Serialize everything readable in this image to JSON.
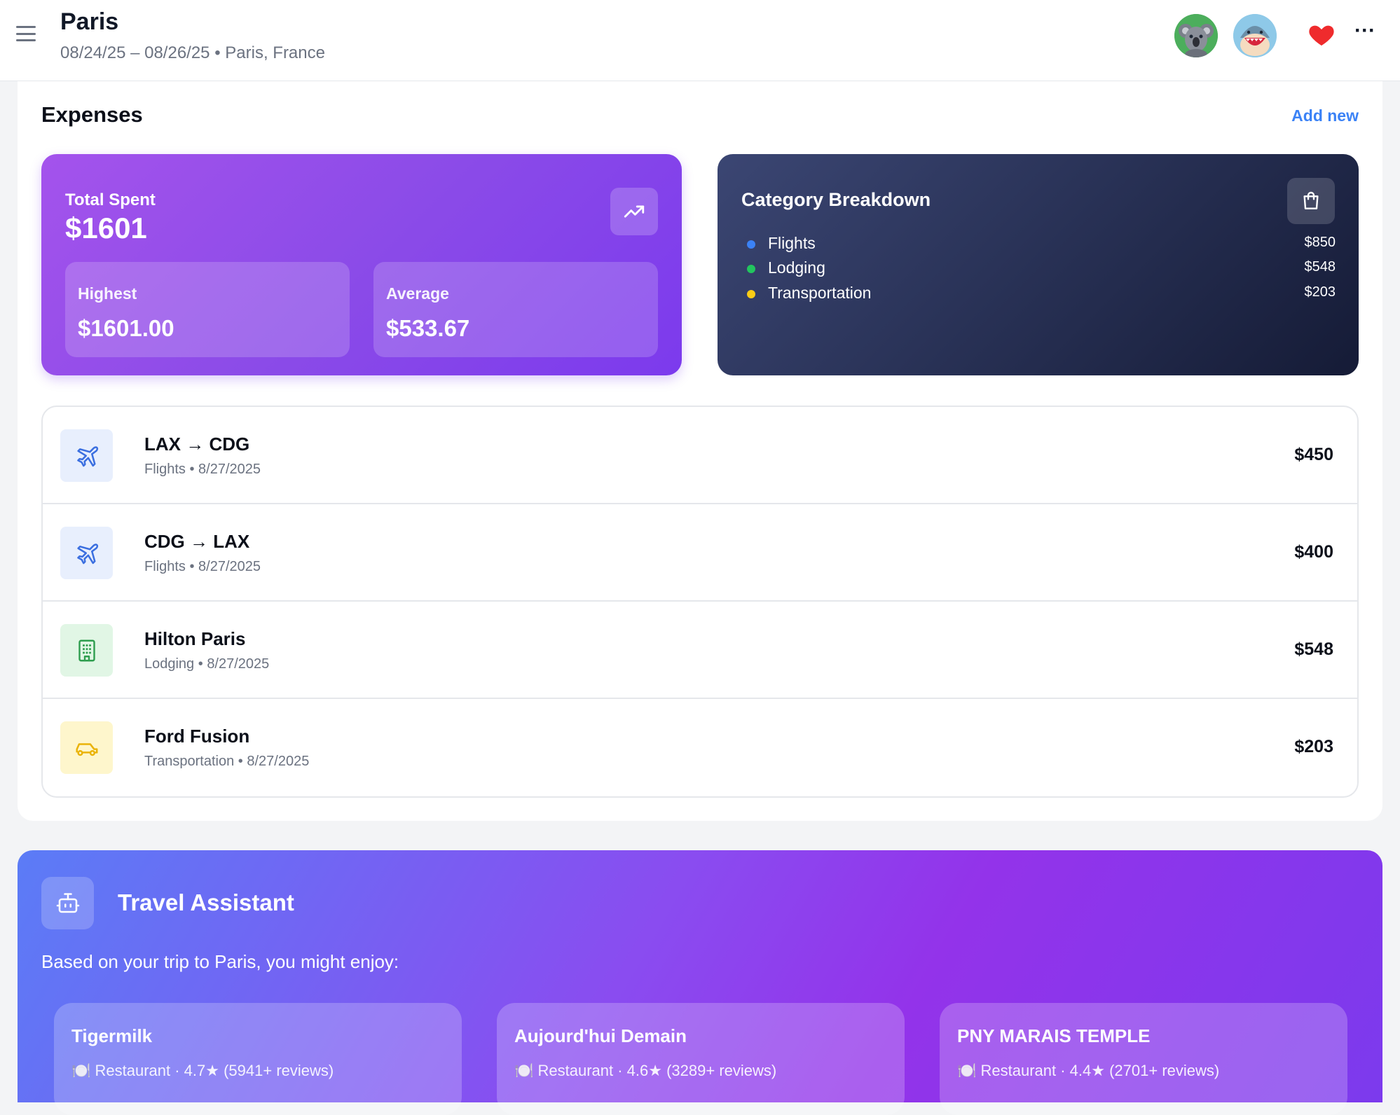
{
  "header": {
    "title": "Paris",
    "subtitle": "08/24/25 – 08/26/25 • Paris, France",
    "menu_icon": "hamburger-icon",
    "avatars": [
      "koala-avatar",
      "shark-avatar"
    ],
    "favorite_icon": "heart-icon",
    "favorite_color": "#ef2b2d",
    "more_label": "···"
  },
  "expenses": {
    "title": "Expenses",
    "add_new_label": "Add new",
    "total": {
      "label": "Total Spent",
      "value": "$1601",
      "icon": "trending-up-icon",
      "highest_label": "Highest",
      "highest_value": "$1601.00",
      "average_label": "Average",
      "average_value": "$533.67"
    },
    "breakdown": {
      "title": "Category Breakdown",
      "icon": "shopping-bag-icon",
      "items": [
        {
          "name": "Flights",
          "amount": "$850",
          "color": "#3b82f6"
        },
        {
          "name": "Lodging",
          "amount": "$548",
          "color": "#22c55e"
        },
        {
          "name": "Transportation",
          "amount": "$203",
          "color": "#facc15"
        }
      ]
    },
    "items": [
      {
        "title": "LAX → CDG",
        "category": "Flights",
        "date": "8/27/2025",
        "amount": "$450",
        "icon": "airplane-icon"
      },
      {
        "title": "CDG → LAX",
        "category": "Flights",
        "date": "8/27/2025",
        "amount": "$400",
        "icon": "airplane-icon"
      },
      {
        "title": "Hilton Paris",
        "category": "Lodging",
        "date": "8/27/2025",
        "amount": "$548",
        "icon": "building-icon"
      },
      {
        "title": "Ford Fusion",
        "category": "Transportation",
        "date": "8/27/2025",
        "amount": "$203",
        "icon": "car-icon"
      }
    ]
  },
  "assistant": {
    "title": "Travel Assistant",
    "icon": "robot-icon",
    "intro": "Based on your trip to Paris, you might enjoy:",
    "recommendations": [
      {
        "name": "Tigermilk",
        "meta": "🍽️ Restaurant · 4.7★ (5941+ reviews)"
      },
      {
        "name": "Aujourd'hui Demain",
        "meta": "🍽️ Restaurant · 4.6★ (3289+ reviews)"
      },
      {
        "name": "PNY MARAIS TEMPLE",
        "meta": "🍽️ Restaurant · 4.4★ (2701+ reviews)"
      }
    ]
  }
}
